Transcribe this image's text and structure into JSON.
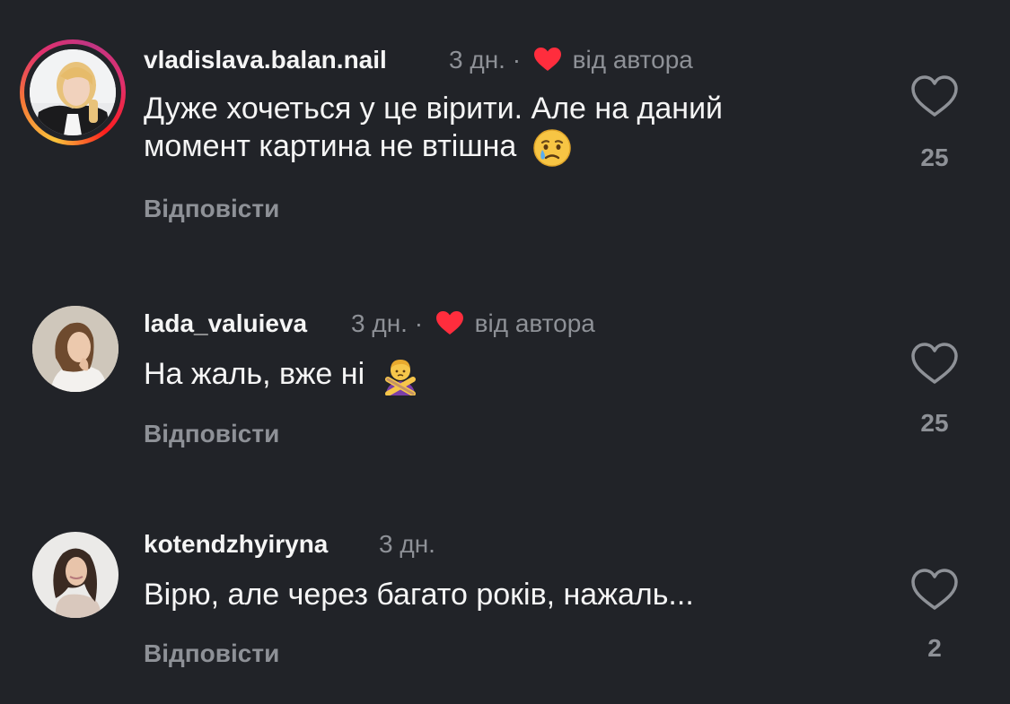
{
  "comments": [
    {
      "username": "vladislava.balan.nail",
      "time": "3 дн.",
      "separator": "·",
      "author_like": "від автора",
      "text_line1": "Дуже хочеться у це вірити. Але на даний",
      "text_line2": "момент картина не втішна",
      "emoji": "crying-face",
      "reply": "Відповісти",
      "likes": "25"
    },
    {
      "username": "lada_valuieva",
      "time": "3 дн.",
      "separator": "·",
      "author_like": "від автора",
      "text_line1": "На жаль, вже ні",
      "emoji": "person-gesturing-no",
      "reply": "Відповісти",
      "likes": "25"
    },
    {
      "username": "kotendzhyiryna",
      "time": "3 дн.",
      "text_line1": "Вірю, але через багато років, нажаль...",
      "reply": "Відповісти",
      "likes": "2"
    }
  ],
  "colors": {
    "background": "#212328",
    "primary_text": "#f5f5f5",
    "secondary_text": "#8e9197",
    "author_heart": "#ff2d3d",
    "story_ring": [
      "#f9c33b",
      "#e1306c",
      "#c13584"
    ]
  }
}
